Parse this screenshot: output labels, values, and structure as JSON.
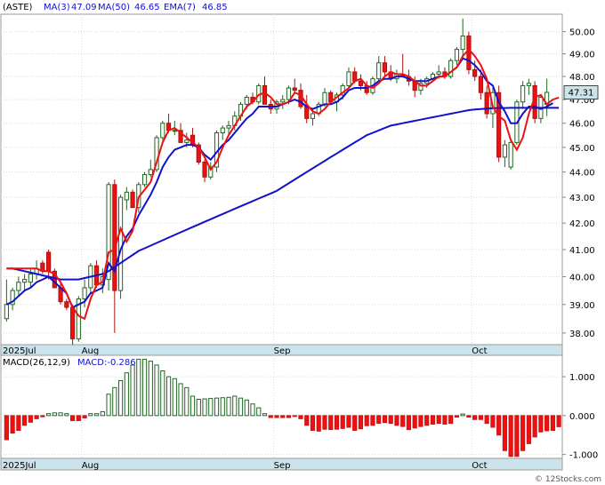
{
  "chart_data": [
    {
      "type": "candlestick",
      "panel": "price",
      "ticker_label": "(ASTE)",
      "indicators": [
        {
          "label": "MA(3)",
          "value": "47.09",
          "color": "#ee1111"
        },
        {
          "label": "MA(50)",
          "value": "46.65",
          "color": "#1111cc"
        },
        {
          "label": "EMA(7)",
          "value": "46.85",
          "color": "#1111cc"
        }
      ],
      "last_price_label": "47.31",
      "ylim": [
        37.6,
        50.8
      ],
      "y_scale": "log",
      "y_ticks": [
        "50.00",
        "49.00",
        "48.00",
        "47.00",
        "46.00",
        "45.00",
        "44.00",
        "43.00",
        "42.00",
        "41.00",
        "40.00",
        "39.00",
        "38.00"
      ],
      "x_labels": [
        {
          "label": "2025Jul",
          "bar": 0
        },
        {
          "label": "Aug",
          "bar": 13
        },
        {
          "label": "Sep",
          "bar": 45
        },
        {
          "label": "Oct",
          "bar": 78
        }
      ],
      "candles": [
        [
          38.5,
          39.9,
          38.4,
          39.0
        ],
        [
          39.0,
          39.6,
          38.8,
          39.5
        ],
        [
          39.5,
          40.0,
          39.3,
          39.8
        ],
        [
          39.8,
          40.1,
          39.5,
          39.9
        ],
        [
          39.8,
          40.3,
          39.6,
          40.1
        ],
        [
          40.1,
          40.6,
          39.9,
          40.3
        ],
        [
          40.5,
          40.6,
          40.1,
          40.2
        ],
        [
          40.9,
          41.0,
          39.9,
          40.2
        ],
        [
          40.2,
          40.3,
          39.6,
          39.6
        ],
        [
          39.6,
          39.8,
          39.0,
          39.1
        ],
        [
          39.1,
          39.2,
          38.8,
          38.9
        ],
        [
          38.9,
          39.0,
          37.6,
          37.8
        ],
        [
          37.8,
          39.3,
          37.7,
          39.2
        ],
        [
          39.2,
          39.9,
          38.9,
          39.6
        ],
        [
          39.6,
          40.5,
          39.4,
          40.4
        ],
        [
          40.4,
          40.6,
          39.6,
          39.7
        ],
        [
          39.7,
          40.3,
          39.4,
          40.0
        ],
        [
          39.9,
          43.6,
          39.5,
          43.5
        ],
        [
          43.5,
          43.7,
          38.0,
          39.5
        ],
        [
          39.5,
          43.1,
          39.2,
          43.0
        ],
        [
          42.9,
          43.4,
          42.5,
          43.2
        ],
        [
          43.2,
          43.3,
          42.6,
          42.6
        ],
        [
          42.6,
          43.6,
          42.4,
          43.5
        ],
        [
          43.5,
          44.0,
          43.4,
          43.9
        ],
        [
          43.9,
          44.5,
          43.8,
          44.1
        ],
        [
          44.1,
          45.5,
          44.0,
          45.4
        ],
        [
          45.4,
          46.1,
          45.3,
          46.0
        ],
        [
          46.0,
          46.4,
          45.6,
          45.7
        ],
        [
          45.7,
          46.1,
          45.5,
          45.7
        ],
        [
          45.7,
          46.0,
          45.2,
          45.2
        ],
        [
          45.2,
          45.6,
          45.0,
          45.3
        ],
        [
          45.5,
          45.8,
          45.0,
          45.1
        ],
        [
          45.1,
          45.2,
          44.3,
          44.4
        ],
        [
          44.4,
          44.5,
          43.6,
          43.8
        ],
        [
          43.8,
          44.4,
          43.7,
          44.2
        ],
        [
          44.2,
          45.7,
          44.0,
          45.6
        ],
        [
          45.6,
          45.9,
          45.3,
          45.8
        ],
        [
          45.8,
          46.1,
          45.5,
          45.9
        ],
        [
          45.9,
          46.5,
          45.7,
          46.3
        ],
        [
          46.3,
          46.9,
          46.1,
          46.8
        ],
        [
          46.8,
          47.2,
          46.6,
          47.1
        ],
        [
          47.1,
          47.3,
          46.8,
          46.9
        ],
        [
          46.9,
          47.7,
          46.8,
          47.6
        ],
        [
          47.6,
          48.0,
          46.8,
          46.8
        ],
        [
          46.8,
          47.0,
          46.4,
          46.6
        ],
        [
          46.6,
          47.0,
          46.4,
          46.9
        ],
        [
          46.9,
          47.2,
          46.6,
          47.0
        ],
        [
          47.0,
          47.6,
          46.8,
          47.5
        ],
        [
          47.5,
          47.9,
          47.3,
          47.4
        ],
        [
          47.4,
          47.7,
          46.6,
          46.7
        ],
        [
          46.7,
          47.2,
          46.0,
          46.2
        ],
        [
          46.2,
          46.6,
          45.9,
          46.4
        ],
        [
          46.4,
          46.9,
          46.3,
          46.8
        ],
        [
          46.8,
          47.5,
          46.7,
          47.3
        ],
        [
          47.3,
          47.4,
          46.8,
          46.9
        ],
        [
          46.9,
          47.3,
          46.5,
          47.2
        ],
        [
          47.2,
          47.7,
          47.0,
          47.6
        ],
        [
          47.6,
          48.4,
          47.5,
          48.2
        ],
        [
          48.2,
          48.4,
          47.7,
          47.8
        ],
        [
          47.8,
          48.1,
          47.4,
          47.6
        ],
        [
          47.6,
          47.8,
          47.2,
          47.3
        ],
        [
          47.3,
          48.0,
          47.2,
          47.9
        ],
        [
          47.9,
          48.9,
          47.8,
          48.6
        ],
        [
          48.6,
          48.9,
          48.0,
          48.2
        ],
        [
          48.2,
          48.5,
          47.8,
          47.9
        ],
        [
          47.9,
          48.3,
          47.7,
          48.1
        ],
        [
          48.1,
          49.0,
          48.0,
          48.0
        ],
        [
          48.0,
          48.3,
          47.6,
          47.8
        ],
        [
          47.8,
          48.0,
          47.1,
          47.4
        ],
        [
          47.4,
          47.9,
          47.2,
          47.7
        ],
        [
          47.7,
          48.0,
          47.5,
          47.9
        ],
        [
          47.9,
          48.2,
          47.8,
          48.1
        ],
        [
          48.1,
          48.5,
          47.9,
          48.2
        ],
        [
          48.2,
          48.4,
          47.9,
          48.0
        ],
        [
          48.0,
          48.8,
          47.9,
          48.7
        ],
        [
          48.7,
          49.3,
          48.5,
          49.2
        ],
        [
          49.2,
          50.6,
          48.8,
          49.8
        ],
        [
          49.8,
          50.0,
          48.1,
          48.3
        ],
        [
          48.3,
          48.7,
          47.8,
          48.0
        ],
        [
          48.0,
          48.3,
          47.0,
          47.3
        ],
        [
          47.3,
          47.6,
          46.2,
          46.4
        ],
        [
          46.4,
          47.5,
          45.8,
          47.3
        ],
        [
          47.3,
          47.6,
          44.4,
          44.6
        ],
        [
          44.6,
          45.3,
          44.2,
          45.1
        ],
        [
          44.2,
          45.3,
          44.1,
          45.2
        ],
        [
          45.2,
          47.0,
          45.1,
          46.9
        ],
        [
          46.9,
          47.8,
          46.6,
          47.6
        ],
        [
          47.6,
          47.9,
          47.2,
          47.7
        ],
        [
          47.6,
          47.8,
          46.0,
          46.2
        ],
        [
          46.2,
          47.2,
          46.0,
          47.1
        ],
        [
          46.8,
          47.9,
          46.3,
          47.31
        ]
      ],
      "series": [
        {
          "name": "MA(3)",
          "color": "#ee1111",
          "values": [
            40.3,
            40.3,
            40.3,
            40.3,
            40.3,
            40.3,
            40.2,
            40.2,
            40.1,
            39.8,
            39.4,
            38.9,
            38.6,
            38.5,
            39.2,
            39.7,
            39.8,
            40.9,
            41.0,
            41.8,
            41.3,
            41.7,
            43.0,
            43.3,
            43.6,
            44.4,
            45.2,
            45.7,
            45.8,
            45.6,
            45.4,
            45.2,
            45.0,
            44.6,
            44.1,
            44.4,
            45.0,
            45.5,
            45.9,
            46.3,
            46.7,
            46.9,
            47.2,
            47.3,
            47.1,
            46.8,
            46.8,
            46.9,
            47.3,
            47.2,
            46.8,
            46.5,
            46.4,
            46.6,
            46.9,
            47.1,
            47.3,
            47.5,
            47.8,
            47.9,
            47.6,
            47.5,
            47.7,
            48.0,
            48.2,
            48.1,
            48.1,
            48.0,
            47.8,
            47.6,
            47.6,
            47.8,
            48.0,
            48.0,
            48.2,
            48.4,
            48.9,
            49.2,
            48.9,
            48.5,
            47.9,
            46.7,
            46.3,
            46.1,
            45.3,
            44.9,
            45.4,
            46.4,
            47.1,
            47.2,
            46.8,
            47.0,
            47.09
          ]
        },
        {
          "name": "MA(50)",
          "color": "#1111cc",
          "values": [
            40.3,
            40.3,
            40.25,
            40.2,
            40.15,
            40.1,
            40.05,
            40.0,
            39.95,
            39.9,
            39.9,
            39.9,
            39.9,
            39.95,
            40.0,
            40.05,
            40.1,
            40.2,
            40.35,
            40.5,
            40.65,
            40.8,
            40.95,
            41.05,
            41.15,
            41.25,
            41.35,
            41.45,
            41.55,
            41.65,
            41.75,
            41.85,
            41.95,
            42.05,
            42.15,
            42.25,
            42.35,
            42.45,
            42.55,
            42.65,
            42.75,
            42.85,
            42.95,
            43.05,
            43.15,
            43.25,
            43.4,
            43.55,
            43.7,
            43.85,
            44.0,
            44.15,
            44.3,
            44.45,
            44.6,
            44.75,
            44.9,
            45.05,
            45.2,
            45.35,
            45.5,
            45.6,
            45.7,
            45.8,
            45.9,
            45.95,
            46.0,
            46.05,
            46.1,
            46.15,
            46.2,
            46.25,
            46.3,
            46.35,
            46.4,
            46.45,
            46.5,
            46.55,
            46.58,
            46.6,
            46.62,
            46.63,
            46.64,
            46.64,
            46.65,
            46.65,
            46.65,
            46.65,
            46.65,
            46.65,
            46.65,
            46.65,
            46.65
          ]
        },
        {
          "name": "EMA(7)",
          "color": "#1111cc",
          "values": [
            39.0,
            39.1,
            39.3,
            39.5,
            39.6,
            39.8,
            39.9,
            40.0,
            39.8,
            39.6,
            39.4,
            38.9,
            39.0,
            39.1,
            39.4,
            39.5,
            39.6,
            40.5,
            40.2,
            41.0,
            41.5,
            41.8,
            42.3,
            42.7,
            43.1,
            43.6,
            44.2,
            44.6,
            44.9,
            45.0,
            45.1,
            45.1,
            45.0,
            44.7,
            44.5,
            44.8,
            45.1,
            45.3,
            45.6,
            45.9,
            46.2,
            46.4,
            46.7,
            46.7,
            46.7,
            46.7,
            46.8,
            46.9,
            47.0,
            46.9,
            46.7,
            46.6,
            46.7,
            46.8,
            46.8,
            46.9,
            47.1,
            47.4,
            47.5,
            47.5,
            47.5,
            47.6,
            47.8,
            47.9,
            47.9,
            48.0,
            48.0,
            47.9,
            47.8,
            47.8,
            47.8,
            47.9,
            48.0,
            48.0,
            48.2,
            48.4,
            48.8,
            48.7,
            48.5,
            48.2,
            47.8,
            47.6,
            46.9,
            46.5,
            46.0,
            46.0,
            46.4,
            46.7,
            46.7,
            46.6,
            46.7,
            46.85
          ]
        }
      ]
    },
    {
      "type": "bar",
      "panel": "macd",
      "label_prefix": "MACD(26,12,9)",
      "label_value": "MACD:-0.286",
      "ylim": [
        -1.1,
        1.55
      ],
      "y_ticks": [
        "1.000",
        "0.000",
        "-1.000"
      ],
      "x_labels": [
        {
          "label": "2025Jul",
          "bar": 0
        },
        {
          "label": "Aug",
          "bar": 13
        },
        {
          "label": "Sep",
          "bar": 45
        },
        {
          "label": "Oct",
          "bar": 78
        }
      ],
      "values": [
        -0.62,
        -0.45,
        -0.38,
        -0.25,
        -0.17,
        -0.08,
        -0.03,
        0.05,
        0.07,
        0.07,
        0.05,
        -0.13,
        -0.13,
        -0.06,
        0.05,
        0.05,
        0.1,
        0.55,
        0.72,
        0.9,
        1.1,
        1.3,
        1.45,
        1.45,
        1.4,
        1.3,
        1.15,
        1.0,
        0.95,
        0.82,
        0.72,
        0.5,
        0.42,
        0.43,
        0.44,
        0.45,
        0.46,
        0.47,
        0.5,
        0.45,
        0.4,
        0.3,
        0.2,
        0.05,
        -0.05,
        -0.05,
        -0.05,
        -0.05,
        -0.02,
        -0.08,
        -0.25,
        -0.38,
        -0.4,
        -0.35,
        -0.36,
        -0.35,
        -0.33,
        -0.3,
        -0.38,
        -0.34,
        -0.26,
        -0.25,
        -0.2,
        -0.18,
        -0.2,
        -0.25,
        -0.28,
        -0.36,
        -0.32,
        -0.28,
        -0.25,
        -0.22,
        -0.2,
        -0.22,
        -0.2,
        -0.04,
        0.04,
        -0.04,
        -0.1,
        -0.1,
        -0.2,
        -0.3,
        -0.5,
        -0.9,
        -1.05,
        -1.05,
        -0.9,
        -0.72,
        -0.55,
        -0.42,
        -0.39,
        -0.38,
        -0.286
      ]
    }
  ],
  "footer": "© 12Stocks.com"
}
